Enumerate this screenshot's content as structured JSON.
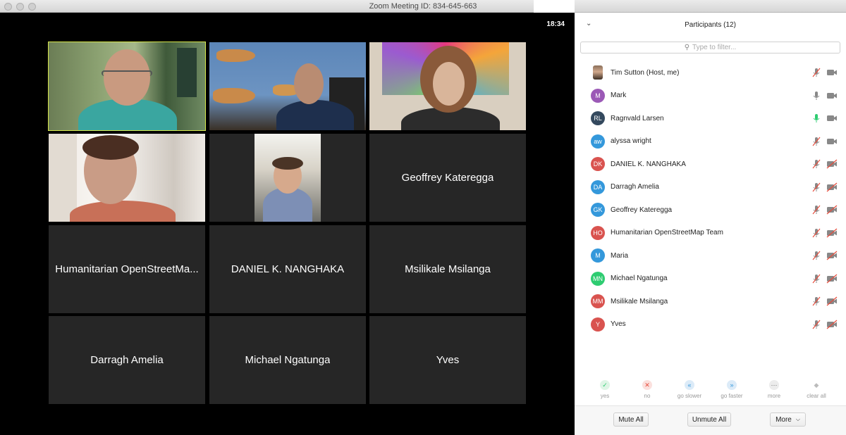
{
  "window": {
    "title": "Zoom Meeting ID: 834-645-663"
  },
  "video": {
    "clock": "18:34",
    "tiles": [
      {
        "name": "",
        "kind": "video"
      },
      {
        "name": "",
        "kind": "video"
      },
      {
        "name": "",
        "kind": "video"
      },
      {
        "name": "",
        "kind": "video"
      },
      {
        "name": "",
        "kind": "video"
      },
      {
        "name": "Geoffrey Kateregga",
        "kind": "name"
      },
      {
        "name": "Humanitarian OpenStreetMa...",
        "kind": "name"
      },
      {
        "name": "DANIEL K. NANGHAKA",
        "kind": "name"
      },
      {
        "name": "Msilikale Msilanga",
        "kind": "name"
      },
      {
        "name": "Darragh Amelia",
        "kind": "name"
      },
      {
        "name": "Michael Ngatunga",
        "kind": "name"
      },
      {
        "name": "Yves",
        "kind": "name"
      }
    ]
  },
  "panel": {
    "title": "Participants (12)",
    "search_placeholder": "Type to filter...",
    "participants": [
      {
        "initials": "",
        "name": "Tim Sutton (Host, me)",
        "color": "#8a6f5a",
        "photo": true,
        "mic": "muted",
        "video": "on"
      },
      {
        "initials": "M",
        "name": "Mark",
        "color": "#9b59b6",
        "mic": "on",
        "video": "on"
      },
      {
        "initials": "RL",
        "name": "Ragnvald Larsen",
        "color": "#34495e",
        "mic": "active",
        "video": "on"
      },
      {
        "initials": "aw",
        "name": "alyssa wright",
        "color": "#3498db",
        "mic": "muted",
        "video": "on"
      },
      {
        "initials": "DK",
        "name": "DANIEL K. NANGHAKA",
        "color": "#d9534f",
        "mic": "muted",
        "video": "off"
      },
      {
        "initials": "DA",
        "name": "Darragh Amelia",
        "color": "#3498db",
        "mic": "muted",
        "video": "off"
      },
      {
        "initials": "GK",
        "name": "Geoffrey Kateregga",
        "color": "#3498db",
        "mic": "muted",
        "video": "off"
      },
      {
        "initials": "HO",
        "name": "Humanitarian OpenStreetMap Team",
        "color": "#d9534f",
        "mic": "muted",
        "video": "off"
      },
      {
        "initials": "M",
        "name": "Maria",
        "color": "#3498db",
        "mic": "muted",
        "video": "off"
      },
      {
        "initials": "MN",
        "name": "Michael Ngatunga",
        "color": "#2ecc71",
        "mic": "muted",
        "video": "off"
      },
      {
        "initials": "MM",
        "name": "Msilikale Msilanga",
        "color": "#d9534f",
        "mic": "muted",
        "video": "off"
      },
      {
        "initials": "Y",
        "name": "Yves",
        "color": "#d9534f",
        "mic": "muted",
        "video": "off"
      }
    ],
    "reactions": [
      {
        "label": "yes",
        "icon": "check-icon",
        "glyph": "✓",
        "color": "#2ecc71",
        "bg": "#dff5e6"
      },
      {
        "label": "no",
        "icon": "x-icon",
        "glyph": "✕",
        "color": "#e74c3c",
        "bg": "#fbe0dd"
      },
      {
        "label": "go slower",
        "icon": "rewind-icon",
        "glyph": "«",
        "color": "#3498db",
        "bg": "#dcebf8"
      },
      {
        "label": "go faster",
        "icon": "forward-icon",
        "glyph": "»",
        "color": "#3498db",
        "bg": "#dcebf8"
      },
      {
        "label": "more",
        "icon": "more-icon",
        "glyph": "···",
        "color": "#666",
        "bg": "#ececec"
      },
      {
        "label": "clear all",
        "icon": "eraser-icon",
        "glyph": "◆",
        "color": "#bbb",
        "bg": "#fff"
      }
    ],
    "footer": {
      "mute_all": "Mute All",
      "unmute_all": "Unmute All",
      "more": "More"
    }
  }
}
